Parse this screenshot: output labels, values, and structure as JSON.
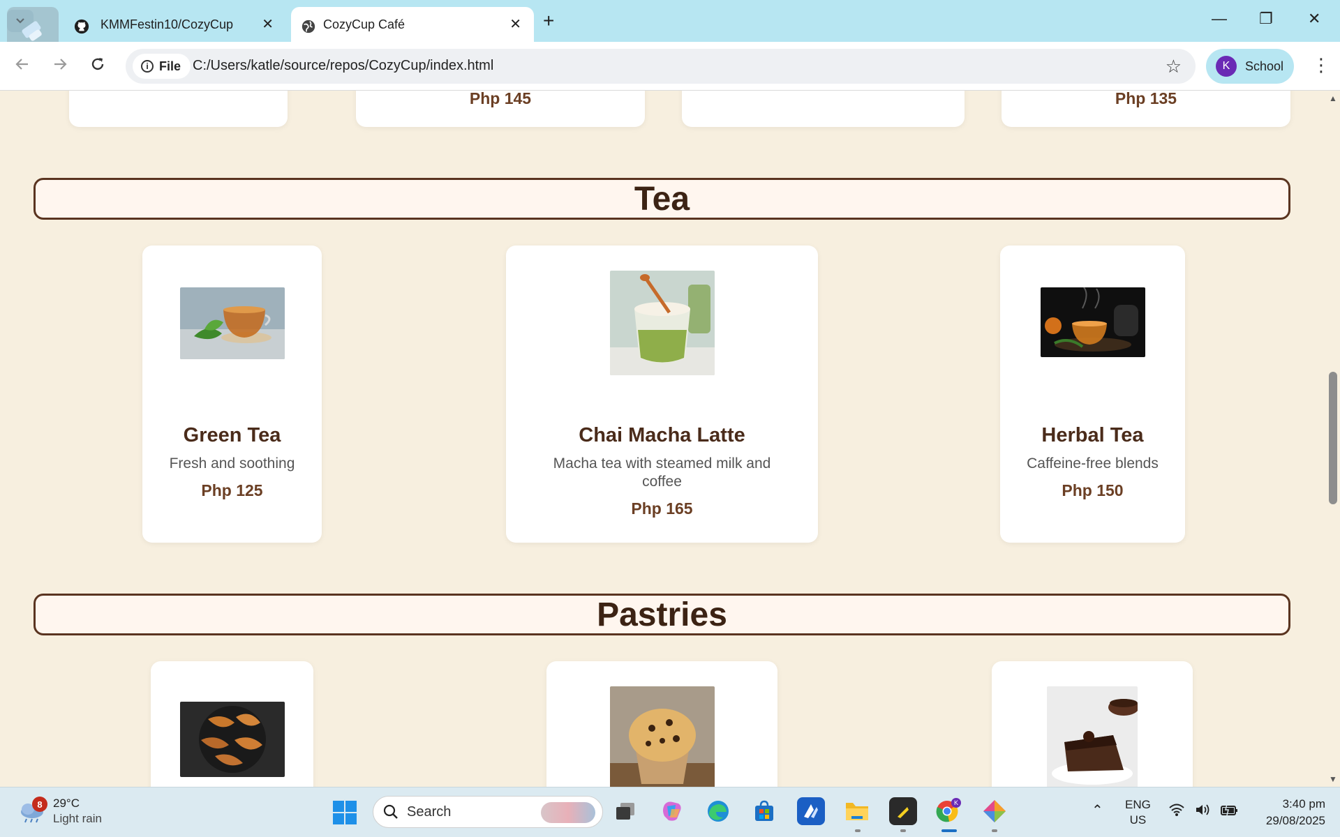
{
  "browser": {
    "tabs": [
      {
        "title": "KMMFestin10/CozyCup",
        "icon": "github-icon",
        "active": false
      },
      {
        "title": "CozyCup Café",
        "icon": "globe-icon",
        "active": true
      }
    ],
    "new_tab": "+",
    "window_controls": {
      "minimize": "—",
      "restore": "❐",
      "close": "✕"
    },
    "address": {
      "chip_label": "File",
      "url": "C:/Users/katle/source/repos/CozyCup/index.html"
    },
    "profile": {
      "initial": "K",
      "label": "School"
    }
  },
  "page": {
    "prev_section": {
      "cards": [
        {
          "price": ""
        },
        {
          "price": "Php 145"
        },
        {
          "price": ""
        },
        {
          "price": "Php 135"
        }
      ]
    },
    "sections": [
      {
        "title": "Tea",
        "items": [
          {
            "name": "Green Tea",
            "desc": "Fresh and soothing",
            "price": "Php 125"
          },
          {
            "name": "Chai Macha Latte",
            "desc": "Macha tea with steamed milk and coffee",
            "price": "Php 165"
          },
          {
            "name": "Herbal Tea",
            "desc": "Caffeine-free blends",
            "price": "Php 150"
          }
        ]
      },
      {
        "title": "Pastries",
        "items": [
          {
            "image": "croissants"
          },
          {
            "image": "muffin"
          },
          {
            "image": "chocolate-cake"
          }
        ]
      }
    ],
    "colors": {
      "background": "#f7efdf",
      "accent": "#5a3420",
      "heading": "#3c2314"
    }
  },
  "taskbar": {
    "weather": {
      "badge": "8",
      "temp": "29°C",
      "condition": "Light rain"
    },
    "search_placeholder": "Search",
    "tray": {
      "lang_top": "ENG",
      "lang_bottom": "US"
    },
    "clock": {
      "time": "3:40 pm",
      "date": "29/08/2025"
    }
  }
}
